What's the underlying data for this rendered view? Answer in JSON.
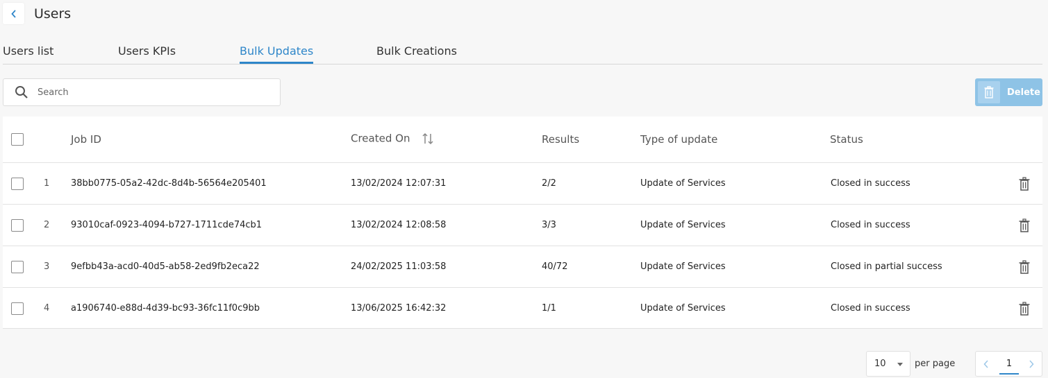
{
  "header": {
    "title": "Users"
  },
  "tabs": [
    {
      "label": "Users list"
    },
    {
      "label": "Users KPIs"
    },
    {
      "label": "Bulk Updates"
    },
    {
      "label": "Bulk Creations"
    }
  ],
  "search": {
    "placeholder": "Search"
  },
  "toolbar": {
    "delete_label": "Delete"
  },
  "table": {
    "columns": {
      "job_id": "Job ID",
      "created_on": "Created On",
      "results": "Results",
      "type": "Type of update",
      "status": "Status"
    },
    "rows": [
      {
        "num": "1",
        "job_id": "38bb0775-05a2-42dc-8d4b-56564e205401",
        "created_on": "13/02/2024 12:07:31",
        "results": "2/2",
        "type": "Update of Services",
        "status": "Closed in success"
      },
      {
        "num": "2",
        "job_id": "93010caf-0923-4094-b727-1711cde74cb1",
        "created_on": "13/02/2024 12:08:58",
        "results": "3/3",
        "type": "Update of Services",
        "status": "Closed in success"
      },
      {
        "num": "3",
        "job_id": "9efbb43a-acd0-40d5-ab58-2ed9fb2eca22",
        "created_on": "24/02/2025 11:03:58",
        "results": "40/72",
        "type": "Update of Services",
        "status": "Closed in partial success"
      },
      {
        "num": "4",
        "job_id": "a1906740-e88d-4d39-bc93-36fc11f0c9bb",
        "created_on": "13/06/2025 16:42:32",
        "results": "1/1",
        "type": "Update of Services",
        "status": "Closed in success"
      }
    ]
  },
  "pagination": {
    "per_page_value": "10",
    "per_page_label": "per page",
    "current_page": "1"
  },
  "colors": {
    "accent": "#2e86c9",
    "success": "#7fa83a",
    "delete_button": "#8ec3e6"
  }
}
